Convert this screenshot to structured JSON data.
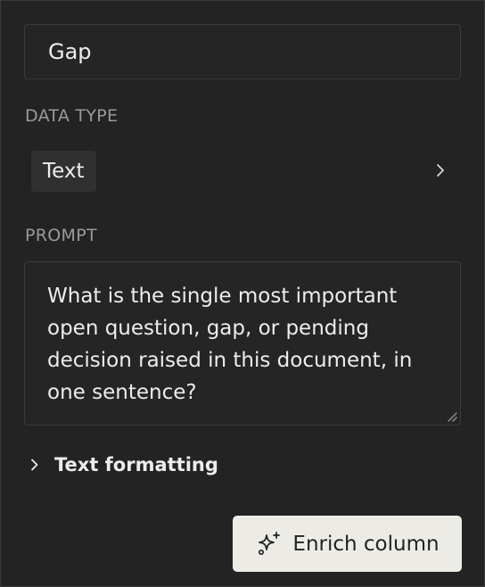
{
  "name_field": {
    "value": "Gap"
  },
  "data_type": {
    "label": "DATA TYPE",
    "selected": "Text",
    "chevron_icon": "chevron-right-icon"
  },
  "prompt": {
    "label": "PROMPT",
    "value": "What is the single most important open question, gap, or pending decision raised in this document, in one sentence?"
  },
  "text_formatting": {
    "label": "Text formatting",
    "chevron_icon": "chevron-right-icon",
    "expanded": false
  },
  "enrich_button": {
    "label": "Enrich column",
    "icon": "sparkle-icon"
  },
  "colors": {
    "panel_background": "#232323",
    "field_border": "#3b3b3b",
    "label_gray": "#9a9a98",
    "button_background": "#ecebe6"
  }
}
